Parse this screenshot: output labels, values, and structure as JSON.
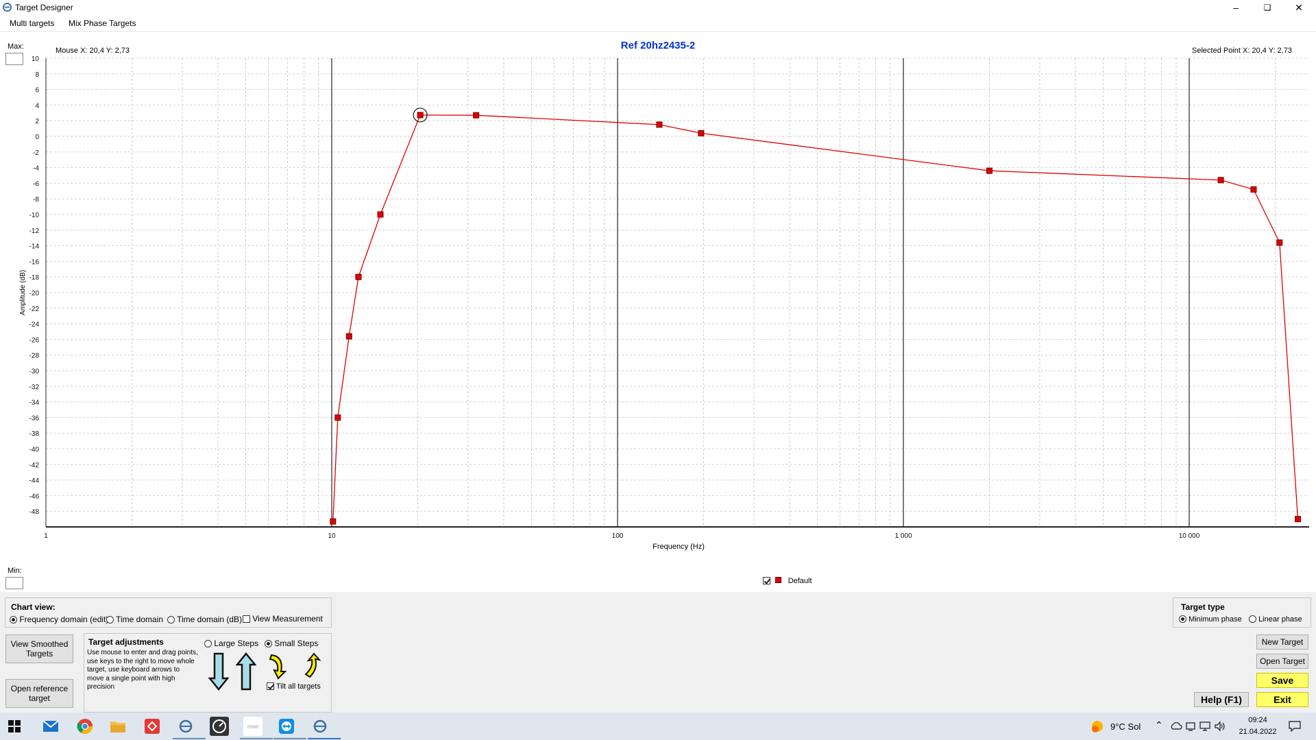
{
  "window": {
    "title": "Target Designer"
  },
  "menu": [
    "Multi targets",
    "Mix Phase Targets"
  ],
  "chart_header": {
    "title": "Ref 20hz2435-2",
    "mouse_label": "Mouse  X: 20,4  Y: 2,73",
    "selected_label": "Selected Point  X: 20,4  Y: 2,73",
    "max_label": "Max:",
    "min_label": "Min:",
    "legend_label": "Default"
  },
  "chart_data": {
    "type": "line",
    "xlabel": "Frequency (Hz)",
    "ylabel": "Amplitude (dB)",
    "xscale": "log",
    "xlim": [
      1,
      43000
    ],
    "ylim": [
      -50,
      10
    ],
    "x_tick_labels": [
      "1",
      "10",
      "100",
      "1 000",
      "10 000"
    ],
    "y_ticks": [
      10,
      8,
      6,
      4,
      2,
      0,
      -2,
      -4,
      -6,
      -8,
      -10,
      -12,
      -14,
      -16,
      -18,
      -20,
      -22,
      -24,
      -26,
      -28,
      -30,
      -32,
      -34,
      -36,
      -38,
      -40,
      -42,
      -44,
      -46,
      -48
    ],
    "grid": true,
    "series": [
      {
        "name": "Default",
        "color": "#e00000",
        "points": [
          {
            "x": 10.1,
            "y": -49.3
          },
          {
            "x": 10.5,
            "y": -36.0
          },
          {
            "x": 11.5,
            "y": -25.6
          },
          {
            "x": 12.4,
            "y": -18.0
          },
          {
            "x": 14.8,
            "y": -10.0
          },
          {
            "x": 20.4,
            "y": 2.73
          },
          {
            "x": 32,
            "y": 2.7
          },
          {
            "x": 140,
            "y": 1.5
          },
          {
            "x": 196,
            "y": 0.4
          },
          {
            "x": 2000,
            "y": -4.4
          },
          {
            "x": 12900,
            "y": -5.6
          },
          {
            "x": 16800,
            "y": -6.8
          },
          {
            "x": 20700,
            "y": -13.6
          },
          {
            "x": 24000,
            "y": -49.0
          }
        ]
      }
    ],
    "selected_point": {
      "x": 20.4,
      "y": 2.73
    }
  },
  "chart_view": {
    "title": "Chart view:",
    "options": [
      "Frequency domain (edit)",
      "Time domain",
      "Time domain (dB)"
    ],
    "view_measurement": "View Measurement"
  },
  "target_adjustments": {
    "title": "Target adjustments",
    "help": "Use mouse to enter and drag points, use keys to the right to move whole target, use keyboard arrows to move a single point with high precision",
    "large_steps": "Large Steps",
    "small_steps": "Small Steps",
    "tilt_all": "Tilt all targets"
  },
  "left_buttons": {
    "view_smoothed": "View Smoothed Targets",
    "open_reference": "Open reference target"
  },
  "target_type": {
    "title": "Target type",
    "minimum": "Minimum phase",
    "linear": "Linear phase"
  },
  "right_buttons": {
    "new": "New Target",
    "open": "Open Target",
    "save": "Save",
    "help": "Help (F1)",
    "exit": "Exit"
  },
  "taskbar": {
    "weather": "9°C  Sol",
    "time": "09:24",
    "date": "21.04.2022"
  }
}
